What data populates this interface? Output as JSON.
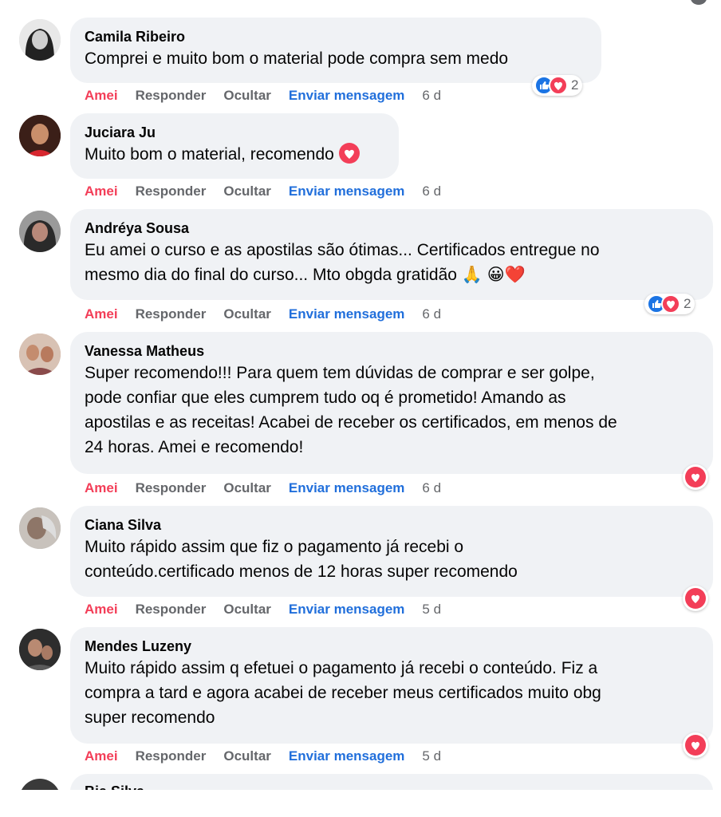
{
  "actions": {
    "love": "Amei",
    "reply": "Responder",
    "hide": "Ocultar",
    "message": "Enviar mensagem"
  },
  "comments": [
    {
      "name": "Camila Ribeiro",
      "lines": [
        "Comprei e muito bom o material pode compra sem medo"
      ],
      "time": "6 d",
      "reaction_count": "2"
    },
    {
      "name": "Juciara Ju",
      "lines": [
        "Muito bom o material, recomendo"
      ],
      "time": "6 d"
    },
    {
      "name": "Andréya Sousa",
      "lines": [
        "Eu amei o curso e as apostilas são ótimas... Certificados entregue no",
        "mesmo dia do final do curso... Mto obgda gratidão 🙏 😀❤️"
      ],
      "time": "6 d",
      "reaction_count": "2"
    },
    {
      "name": "Vanessa Matheus",
      "lines": [
        "Super recomendo!!! Para quem tem dúvidas de comprar e ser golpe,",
        "pode confiar que eles cumprem tudo oq é prometido! Amando as",
        "apostilas e as receitas! Acabei de receber os certificados, em menos de",
        "24 horas. Amei e recomendo!"
      ],
      "time": "6 d"
    },
    {
      "name": "Ciana Silva",
      "lines": [
        "Muito rápido assim que fiz o pagamento já recebi o",
        "conteúdo.certificado menos de 12 horas super recomendo"
      ],
      "time": "5 d"
    },
    {
      "name": "Mendes Luzeny",
      "lines": [
        "Muito rápido assim q efetuei o pagamento já recebi o conteúdo. Fiz a",
        "compra a tard e agora acabei de receber meus certificados muito obg",
        "super recomendo"
      ],
      "time": "5 d"
    },
    {
      "name": "Bia Silva"
    }
  ],
  "icons": {
    "like": "like-icon",
    "love": "love-icon"
  },
  "colors": {
    "love": "#f33e58",
    "like": "#1b74e4",
    "link": "#216fdb"
  }
}
